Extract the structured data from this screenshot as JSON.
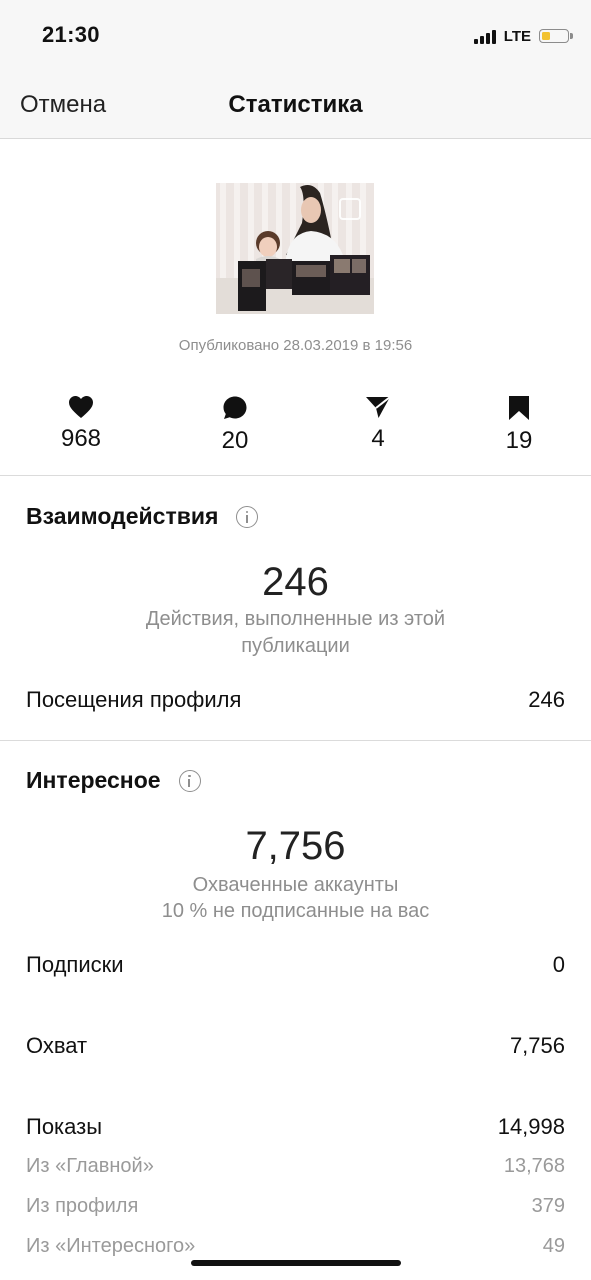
{
  "status_bar": {
    "time": "21:30",
    "network": "LTE"
  },
  "nav": {
    "cancel_label": "Отмена",
    "title": "Статистика"
  },
  "post": {
    "published": "Опубликовано 28.03.2019 в 19:56"
  },
  "stats": {
    "likes": "968",
    "comments": "20",
    "shares": "4",
    "saves": "19"
  },
  "interactions": {
    "title": "Взаимодействия",
    "total": "246",
    "description": "Действия, выполненные из этой публикации",
    "rows": [
      {
        "label": "Посещения профиля",
        "value": "246"
      }
    ]
  },
  "discovery": {
    "title": "Интересное",
    "total": "7,756",
    "description_1": "Охваченные аккаунты",
    "description_2": "10 % не подписанные на вас",
    "rows": [
      {
        "label": "Подписки",
        "value": "0"
      },
      {
        "label": "Охват",
        "value": "7,756"
      },
      {
        "label": "Показы",
        "value": "14,998"
      }
    ],
    "sub_rows": [
      {
        "label": "Из «Главной»",
        "value": "13,768"
      },
      {
        "label": "Из профиля",
        "value": "379"
      },
      {
        "label": "Из «Интересного»",
        "value": "49"
      }
    ]
  },
  "colors": {
    "muted": "#8e8e8e",
    "divider": "#dbdbdb",
    "battery": "#f2c230"
  }
}
